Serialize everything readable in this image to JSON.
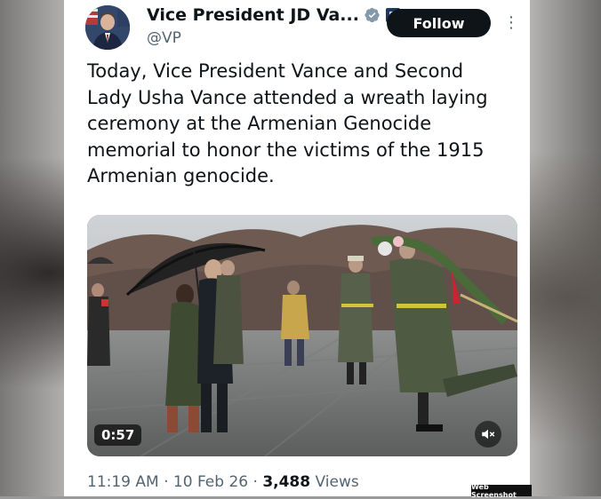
{
  "tweet": {
    "author_name": "Vice President JD Va...",
    "handle": "@VP",
    "follow_label": "Follow",
    "more_glyph": "⋮",
    "text": "Today, Vice President Vance and Second Lady Usha Vance attended a wreath laying ceremony at the Armenian Genocide memorial to honor the victims of the 1915 Armenian genocide.",
    "media": {
      "duration": "0:57",
      "mute_icon": "speaker-muted-icon"
    },
    "time": "11:19 AM",
    "separator": "·",
    "date": "10 Feb 26",
    "views_count": "3,488",
    "views_label": "Views"
  },
  "watermark": "Web Screenshot",
  "colors": {
    "verified": "#1d9bf0",
    "follow_bg": "#0f1419",
    "text": "#0f1419",
    "muted_text": "#536471"
  }
}
